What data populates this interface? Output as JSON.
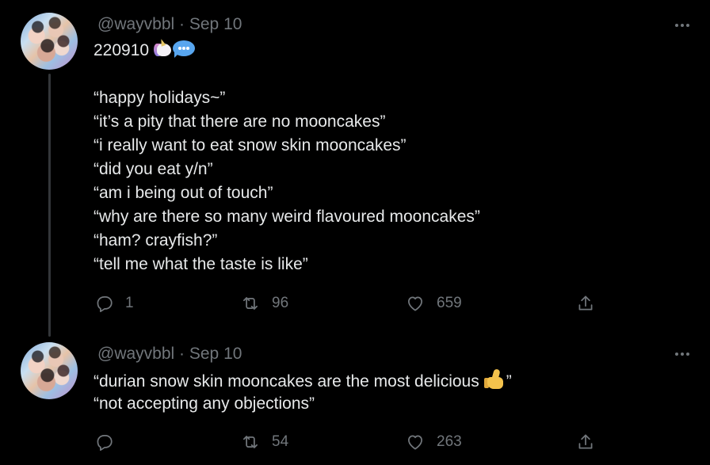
{
  "tweets": [
    {
      "handle": "@wayvbbl",
      "separator": "·",
      "date": "Sep 10",
      "first_line": "220910",
      "emojis": [
        "unicorn-emoji",
        "speech-bubble-emoji"
      ],
      "lines": [
        "“happy holidays~”",
        "“it’s a pity that there are no mooncakes”",
        "“i really want to eat snow skin mooncakes”",
        "“did you eat y/n”",
        "“am i being out of touch”",
        "“why are there so many weird flavoured mooncakes”",
        "“ham? crayfish?”",
        "“tell me what the taste is like”"
      ],
      "replies": "1",
      "retweets": "96",
      "likes": "659"
    },
    {
      "handle": "@wayvbbl",
      "separator": "·",
      "date": "Sep 10",
      "lines": [
        "“durian snow skin mooncakes are the most delicious",
        "”",
        "“not accepting any objections”"
      ],
      "emojis": [
        "thumbs-up-emoji"
      ],
      "replies": "",
      "retweets": "54",
      "likes": "263"
    }
  ],
  "colors": {
    "background": "#000000",
    "text": "#e7e9ea",
    "muted": "#71767b",
    "thread_line": "#333639"
  },
  "icons": [
    "reply-icon",
    "retweet-icon",
    "like-icon",
    "share-icon",
    "more-icon"
  ]
}
